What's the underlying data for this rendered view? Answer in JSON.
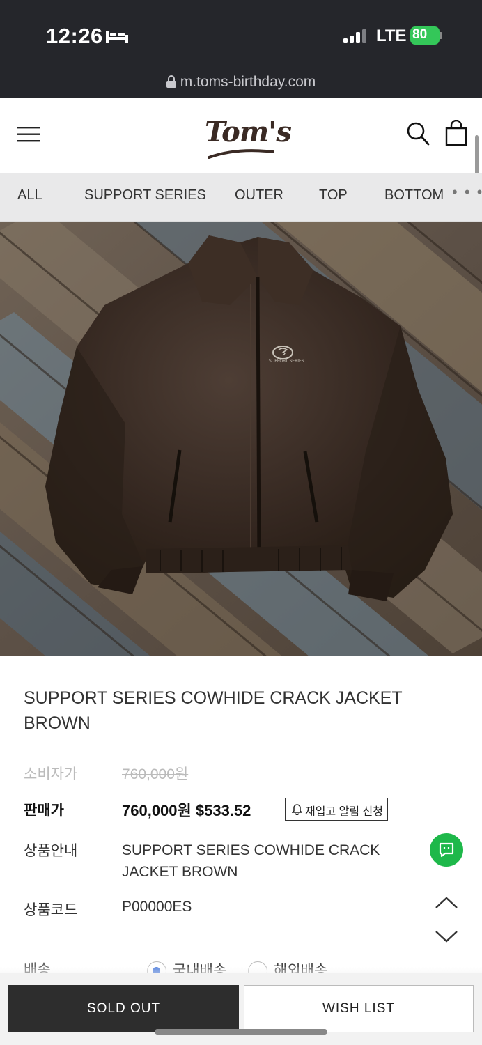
{
  "status_bar": {
    "time": "12:26",
    "network": "LTE",
    "battery": "80"
  },
  "browser": {
    "url": "m.toms-birthday.com"
  },
  "header": {
    "logo": "Tom's"
  },
  "tabs": [
    {
      "label": "ALL"
    },
    {
      "label": "SUPPORT SERIES"
    },
    {
      "label": "OUTER"
    },
    {
      "label": "TOP"
    },
    {
      "label": "BOTTOM"
    }
  ],
  "tabs_more": "• • •",
  "product": {
    "title": "SUPPORT SERIES COWHIDE CRACK JACKET BROWN",
    "jacket_logo_text": "SUPPORT SERIES",
    "consumer_price_label": "소비자가",
    "consumer_price": "760,000원",
    "sale_price_label": "판매가",
    "sale_price": "760,000원 $533.52",
    "restock_button": "재입고 알림 신청",
    "description_label": "상품안내",
    "description": "SUPPORT SERIES COWHIDE CRACK JACKET BROWN",
    "code_label": "상품코드",
    "code": "P00000ES",
    "shipping_label": "배송",
    "shipping_options": [
      {
        "label": "국내배송",
        "selected": true
      },
      {
        "label": "해외배송",
        "selected": false
      }
    ]
  },
  "actions": {
    "sold_out": "SOLD OUT",
    "wish_list": "WISH LIST"
  },
  "colors": {
    "chat": "#1eb84a",
    "dark_button": "#2d2d2d",
    "battery": "#34c759"
  }
}
